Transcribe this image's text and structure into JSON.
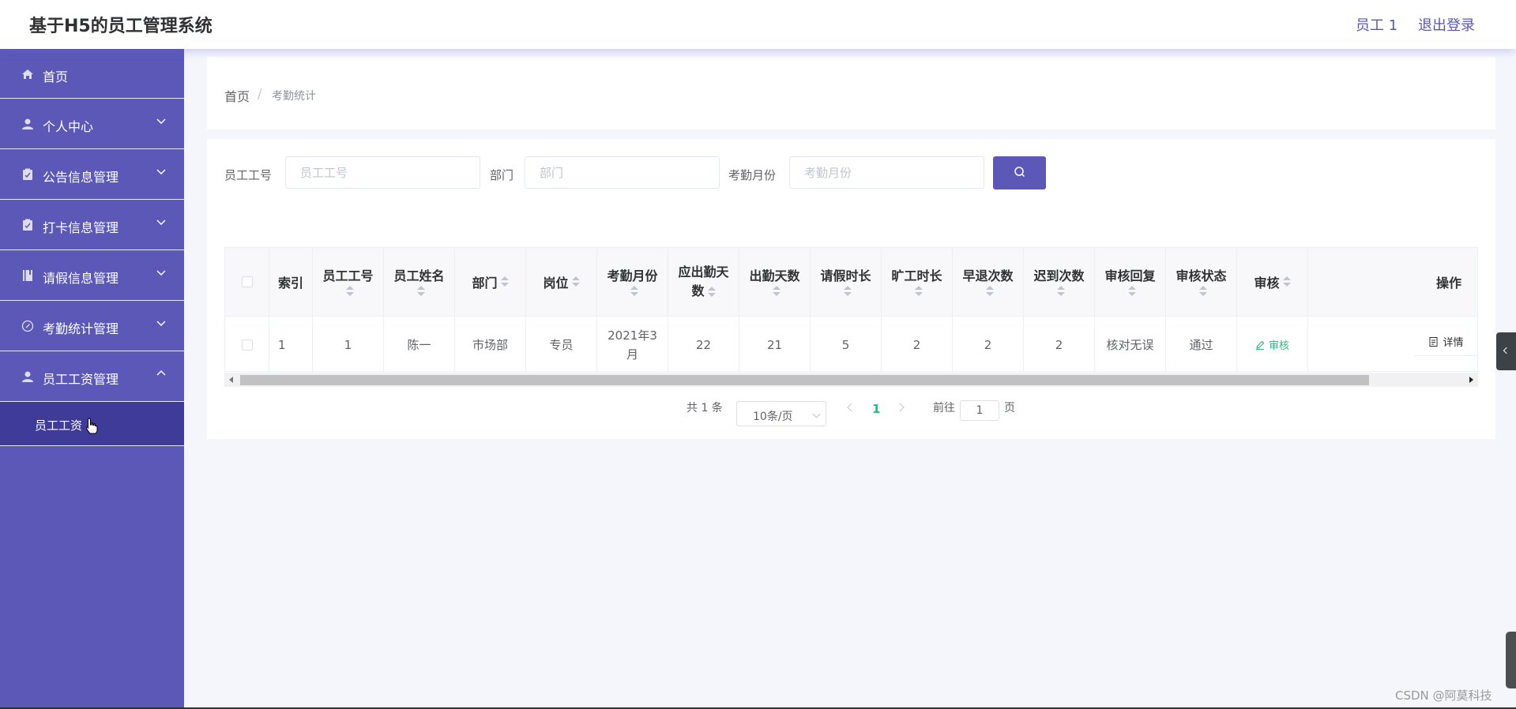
{
  "header": {
    "title": "基于H5的员工管理系统",
    "user": "员工 1",
    "logout": "退出登录"
  },
  "sidebar": {
    "items": [
      {
        "label": "首页",
        "icon": "home-icon"
      },
      {
        "label": "个人中心",
        "icon": "user-icon"
      },
      {
        "label": "公告信息管理",
        "icon": "clipboard-icon"
      },
      {
        "label": "打卡信息管理",
        "icon": "clipboard-icon"
      },
      {
        "label": "请假信息管理",
        "icon": "book-icon"
      },
      {
        "label": "考勤统计管理",
        "icon": "compass-icon"
      },
      {
        "label": "员工工资管理",
        "icon": "user-icon"
      }
    ],
    "active_sub": "员工工资"
  },
  "breadcrumb": {
    "home": "首页",
    "separator": "/",
    "current": "考勤统计"
  },
  "search": {
    "emp_no_label": "员工工号",
    "emp_no_placeholder": "员工工号",
    "dept_label": "部门",
    "dept_placeholder": "部门",
    "month_label": "考勤月份",
    "month_placeholder": "考勤月份"
  },
  "table": {
    "headers": {
      "index": "索引",
      "emp_no": "员工工号",
      "emp_name": "员工姓名",
      "dept": "部门",
      "position": "岗位",
      "month": "考勤月份",
      "due_days_1": "应出勤天",
      "due_days_2": "数",
      "attend_days": "出勤天数",
      "leave_hours": "请假时长",
      "absent_hours": "旷工时长",
      "early_leave": "早退次数",
      "late_count": "迟到次数",
      "audit_reply": "审核回复",
      "audit_status": "审核状态",
      "audit": "审核",
      "ops": "操作"
    },
    "rows": [
      {
        "index": "1",
        "emp_no": "1",
        "emp_name": "陈一",
        "dept": "市场部",
        "position": "专员",
        "month_1": "2021年3",
        "month_2": "月",
        "due_days": "22",
        "attend_days": "21",
        "leave_hours": "5",
        "absent_hours": "2",
        "early_leave": "2",
        "late_count": "2",
        "audit_reply": "核对无误",
        "audit_status": "通过",
        "audit_btn": "审核",
        "detail_btn": "详情"
      }
    ]
  },
  "pagination": {
    "total": "共 1 条",
    "page_size": "10条/页",
    "current_page": "1",
    "goto_label": "前往",
    "goto_value": "1",
    "page_unit": "页"
  },
  "watermark": "CSDN @阿莫科技",
  "colors": {
    "sidebar": "#5b58b8",
    "sidebar_active": "#3f3c99",
    "accent_green": "#36b37e",
    "search_button": "#5b58b8"
  }
}
